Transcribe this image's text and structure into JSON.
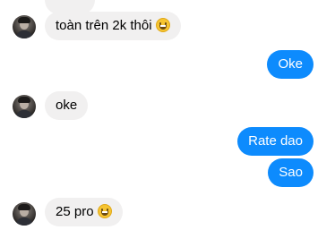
{
  "messages": [
    {
      "id": 0,
      "sender": "them",
      "text": "",
      "partial": true
    },
    {
      "id": 1,
      "sender": "them",
      "text": "toàn trên 2k thôi",
      "emoji": "grinning-face-emoji"
    },
    {
      "id": 2,
      "sender": "me",
      "text": "Oke"
    },
    {
      "id": 3,
      "sender": "them",
      "text": "oke"
    },
    {
      "id": 4,
      "sender": "me",
      "text": "Rate dao"
    },
    {
      "id": 5,
      "sender": "me",
      "text": "Sao"
    },
    {
      "id": 6,
      "sender": "them",
      "text": "25 pro",
      "emoji": "grinning-face-emoji"
    }
  ],
  "colors": {
    "incoming_bubble": "#f1f0f0",
    "outgoing_bubble": "#0d8bfd",
    "incoming_text": "#000000",
    "outgoing_text": "#ffffff"
  }
}
